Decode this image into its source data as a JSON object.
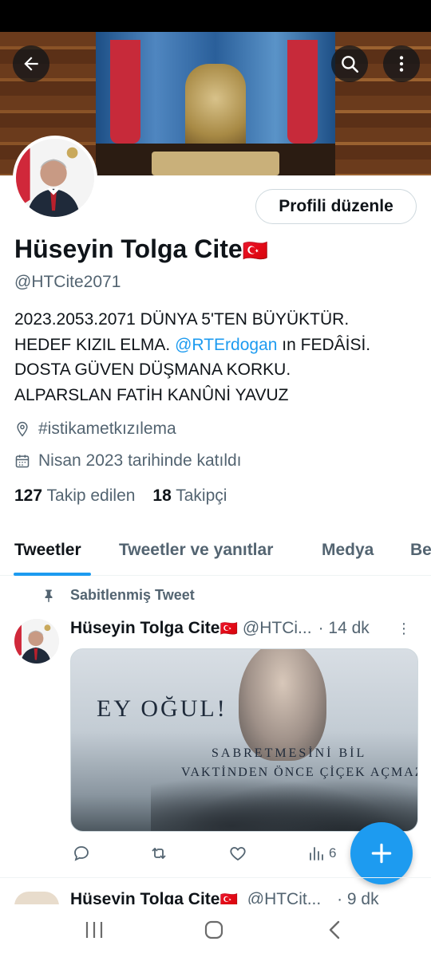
{
  "profile": {
    "display_name": "Hüseyin Tolga Cite",
    "flag_emoji": "🇹🇷",
    "handle": "@HTCite2071",
    "edit_button": "Profili düzenle",
    "bio_line1": "2023.2053.2071 DÜNYA 5'TEN BÜYÜKTÜR.",
    "bio_line2_pre": "HEDEF KIZIL ELMA. ",
    "bio_mention": "@RTErdogan",
    "bio_line2_post": " ın FEDÂİSİ.",
    "bio_line3": "DOSTA GÜVEN DÜŞMANA KORKU.",
    "bio_line4": "ALPARSLAN FATİH KANÛNİ YAVUZ",
    "location": "#istikametkızılema",
    "joined": "Nisan 2023 tarihinde katıldı",
    "following_count": "127",
    "following_label": "Takip edilen",
    "followers_count": "18",
    "followers_label": "Takipçi"
  },
  "tabs": [
    "Tweetler",
    "Tweetler ve yanıtlar",
    "Medya",
    "Be"
  ],
  "active_tab": "Tweetler",
  "pinned_label": "Sabitlenmiş Tweet",
  "tweet": {
    "name": "Hüseyin Tolga Cite",
    "flag": "🇹🇷",
    "handle": "@HTCi...",
    "time": "· 14 dk",
    "media_title": "EY OĞUL!",
    "media_line1": "SABRETMESİNİ BİL",
    "media_line2": "VAKTİNDEN ÖNCE ÇİÇEK AÇMAZ",
    "views": "6"
  },
  "tweet2": {
    "name": "Hüseyin Tolga Cite",
    "flag": "🇹🇷",
    "handle": "@HTCit...",
    "time": "· 9 dk"
  },
  "icons": {
    "back": "arrow-left-icon",
    "search": "search-icon",
    "more": "more-vertical-icon",
    "location": "location-pin-icon",
    "calendar": "calendar-icon",
    "pin": "pin-icon",
    "reply": "reply-icon",
    "retweet": "retweet-icon",
    "like": "heart-icon",
    "views": "views-icon",
    "compose": "plus-icon"
  },
  "colors": {
    "accent": "#1d9bf0",
    "text": "#0f1419",
    "secondary": "#536471"
  }
}
